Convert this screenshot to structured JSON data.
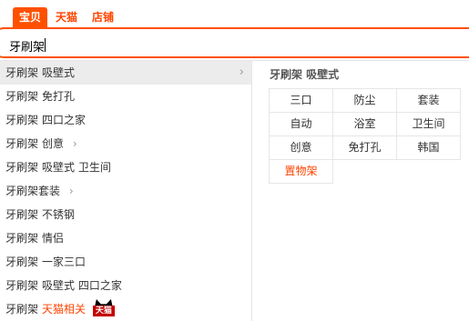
{
  "tabs": [
    {
      "label": "宝贝",
      "active": true
    },
    {
      "label": "天猫",
      "active": false
    },
    {
      "label": "店铺",
      "active": false
    }
  ],
  "search": {
    "value": "牙刷架",
    "placeholder": ""
  },
  "suggestions": [
    {
      "main": "牙刷架",
      "rest": "吸壁式"
    },
    {
      "main": "牙刷架",
      "rest": "免打孔"
    },
    {
      "main": "牙刷架",
      "rest": "四口之家"
    },
    {
      "main": "牙刷架",
      "rest": "创意"
    },
    {
      "main": "牙刷架",
      "rest": "吸壁式 卫生间"
    },
    {
      "main": "牙刷架套装",
      "rest": ""
    },
    {
      "main": "牙刷架",
      "rest": "不锈钢"
    },
    {
      "main": "牙刷架",
      "rest": "情侣"
    },
    {
      "main": "牙刷架",
      "rest": "一家三口"
    },
    {
      "main": "牙刷架",
      "rest": "吸壁式 四口之家"
    },
    {
      "main": "牙刷架",
      "rest": "天猫相关"
    }
  ],
  "tmall_badge": {
    "label": "天猫"
  },
  "panel": {
    "title": "牙刷架 吸壁式",
    "tags": [
      "三口",
      "防尘",
      "套装",
      "自动",
      "浴室",
      "卫生间",
      "创意",
      "免打孔",
      "韩国",
      "置物架"
    ]
  },
  "colors": {
    "accent": "#ff5000",
    "highlight": "#ff4400",
    "tmall_red": "#c40000"
  }
}
